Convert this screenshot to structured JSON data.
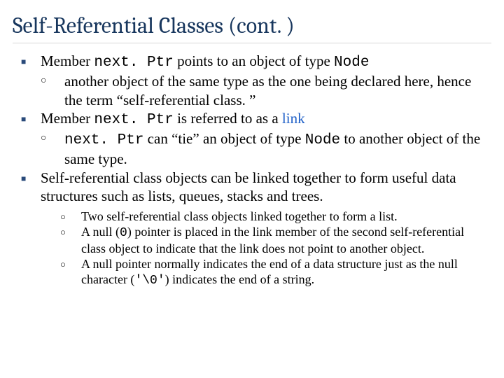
{
  "title": "Self-Referential Classes (cont. )",
  "body": {
    "b1": {
      "pre": "Member ",
      "code1": "next. Ptr",
      "mid": " points to an object of type ",
      "code2": "Node",
      "sub1": "another object of the same type as the one being declared here, hence the term “self-referential class. ”"
    },
    "b2": {
      "pre": "Member ",
      "code1": "next. Ptr",
      "mid": " is referred to as a ",
      "link": "link",
      "sub1": {
        "code1": "next. Ptr",
        "mid": " can “tie” an object of type ",
        "code2": "Node",
        "tail": " to another object of the same type."
      }
    },
    "b3": {
      "text": "Self-referential class objects can be linked together to form useful data structures such as lists, queues, stacks and trees.",
      "sub1": "Two self-referential class objects linked together to form a list.",
      "sub2": {
        "pre": "A null (",
        "code": "0",
        "tail": ") pointer is placed in the link member of the second self-referential class object to indicate that the link does not point to another object."
      },
      "sub3": {
        "pre": "A null pointer normally indicates the end of a data structure just as the null character (",
        "code": "'\\0'",
        "tail": ") indicates the end of a string."
      }
    }
  }
}
